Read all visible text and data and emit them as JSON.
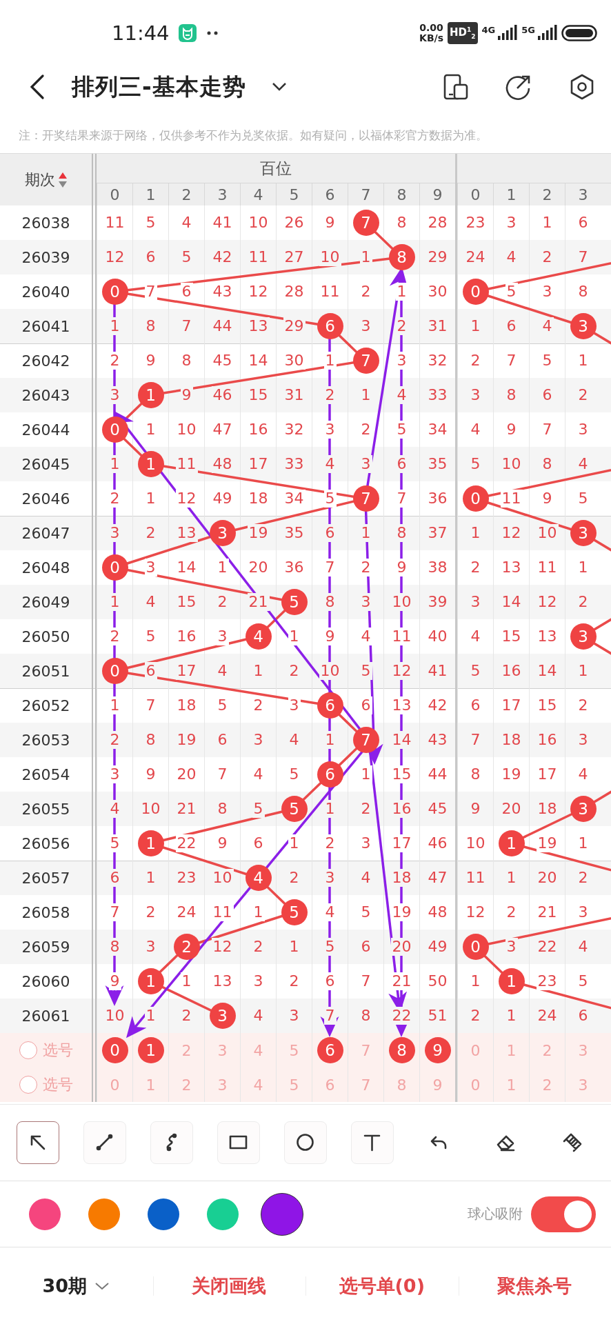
{
  "status_bar": {
    "time": "11:44",
    "net_speed": "0.00",
    "net_unit": "KB/s",
    "hd_badge": "HD$^{1}$$_{2}$",
    "sim_1": "4G",
    "sim_2": "5G"
  },
  "header": {
    "title": "排列三-基本走势"
  },
  "notice": "注：开奖结果来源于网络，仅供参考不作为兑奖依据。如有疑问，以福体彩官方数据为准。",
  "table": {
    "issue_header": "期次",
    "sort_ascending": true,
    "groups": [
      {
        "label": "百位",
        "digits": [
          "0",
          "1",
          "2",
          "3",
          "4",
          "5",
          "6",
          "7",
          "8",
          "9"
        ]
      },
      {
        "digits": [
          "0",
          "1",
          "2",
          "3"
        ]
      }
    ],
    "rows": [
      {
        "issue": "26038",
        "groups": [
          [
            {
              "text": "11",
              "hit": false
            },
            {
              "text": "5",
              "hit": false
            },
            {
              "text": "4",
              "hit": false
            },
            {
              "text": "41",
              "hit": false
            },
            {
              "text": "10",
              "hit": false
            },
            {
              "text": "26",
              "hit": false
            },
            {
              "text": "9",
              "hit": false
            },
            {
              "text": "7",
              "hit": true
            },
            {
              "text": "8",
              "hit": false
            },
            {
              "text": "28",
              "hit": false
            }
          ],
          [
            {
              "text": "23",
              "hit": false
            },
            {
              "text": "3",
              "hit": false
            },
            {
              "text": "1",
              "hit": false
            },
            {
              "text": "6",
              "hit": false
            }
          ]
        ]
      },
      {
        "issue": "26039",
        "groups": [
          [
            {
              "text": "12",
              "hit": false
            },
            {
              "text": "6",
              "hit": false
            },
            {
              "text": "5",
              "hit": false
            },
            {
              "text": "42",
              "hit": false
            },
            {
              "text": "11",
              "hit": false
            },
            {
              "text": "27",
              "hit": false
            },
            {
              "text": "10",
              "hit": false
            },
            {
              "text": "1",
              "hit": false
            },
            {
              "text": "8",
              "hit": true
            },
            {
              "text": "29",
              "hit": false
            }
          ],
          [
            {
              "text": "24",
              "hit": false
            },
            {
              "text": "4",
              "hit": false
            },
            {
              "text": "2",
              "hit": false
            },
            {
              "text": "7",
              "hit": false
            }
          ]
        ]
      },
      {
        "issue": "26040",
        "groups": [
          [
            {
              "text": "0",
              "hit": true
            },
            {
              "text": "7",
              "hit": false
            },
            {
              "text": "6",
              "hit": false
            },
            {
              "text": "43",
              "hit": false
            },
            {
              "text": "12",
              "hit": false
            },
            {
              "text": "28",
              "hit": false
            },
            {
              "text": "11",
              "hit": false
            },
            {
              "text": "2",
              "hit": false
            },
            {
              "text": "1",
              "hit": false
            },
            {
              "text": "30",
              "hit": false
            }
          ],
          [
            {
              "text": "0",
              "hit": true
            },
            {
              "text": "5",
              "hit": false
            },
            {
              "text": "3",
              "hit": false
            },
            {
              "text": "8",
              "hit": false
            }
          ]
        ]
      },
      {
        "issue": "26041",
        "groups": [
          [
            {
              "text": "1",
              "hit": false
            },
            {
              "text": "8",
              "hit": false
            },
            {
              "text": "7",
              "hit": false
            },
            {
              "text": "44",
              "hit": false
            },
            {
              "text": "13",
              "hit": false
            },
            {
              "text": "29",
              "hit": false
            },
            {
              "text": "6",
              "hit": true
            },
            {
              "text": "3",
              "hit": false
            },
            {
              "text": "2",
              "hit": false
            },
            {
              "text": "31",
              "hit": false
            }
          ],
          [
            {
              "text": "1",
              "hit": false
            },
            {
              "text": "6",
              "hit": false
            },
            {
              "text": "4",
              "hit": false
            },
            {
              "text": "3",
              "hit": true
            }
          ]
        ]
      },
      {
        "issue": "26042",
        "groups": [
          [
            {
              "text": "2",
              "hit": false
            },
            {
              "text": "9",
              "hit": false
            },
            {
              "text": "8",
              "hit": false
            },
            {
              "text": "45",
              "hit": false
            },
            {
              "text": "14",
              "hit": false
            },
            {
              "text": "30",
              "hit": false
            },
            {
              "text": "1",
              "hit": false
            },
            {
              "text": "7",
              "hit": true
            },
            {
              "text": "3",
              "hit": false
            },
            {
              "text": "32",
              "hit": false
            }
          ],
          [
            {
              "text": "2",
              "hit": false
            },
            {
              "text": "7",
              "hit": false
            },
            {
              "text": "5",
              "hit": false
            },
            {
              "text": "1",
              "hit": false
            }
          ]
        ]
      },
      {
        "issue": "26043",
        "groups": [
          [
            {
              "text": "3",
              "hit": false
            },
            {
              "text": "1",
              "hit": true
            },
            {
              "text": "9",
              "hit": false
            },
            {
              "text": "46",
              "hit": false
            },
            {
              "text": "15",
              "hit": false
            },
            {
              "text": "31",
              "hit": false
            },
            {
              "text": "2",
              "hit": false
            },
            {
              "text": "1",
              "hit": false
            },
            {
              "text": "4",
              "hit": false
            },
            {
              "text": "33",
              "hit": false
            }
          ],
          [
            {
              "text": "3",
              "hit": false
            },
            {
              "text": "8",
              "hit": false
            },
            {
              "text": "6",
              "hit": false
            },
            {
              "text": "2",
              "hit": false
            }
          ]
        ]
      },
      {
        "issue": "26044",
        "groups": [
          [
            {
              "text": "0",
              "hit": true
            },
            {
              "text": "1",
              "hit": false
            },
            {
              "text": "10",
              "hit": false
            },
            {
              "text": "47",
              "hit": false
            },
            {
              "text": "16",
              "hit": false
            },
            {
              "text": "32",
              "hit": false
            },
            {
              "text": "3",
              "hit": false
            },
            {
              "text": "2",
              "hit": false
            },
            {
              "text": "5",
              "hit": false
            },
            {
              "text": "34",
              "hit": false
            }
          ],
          [
            {
              "text": "4",
              "hit": false
            },
            {
              "text": "9",
              "hit": false
            },
            {
              "text": "7",
              "hit": false
            },
            {
              "text": "3",
              "hit": false
            }
          ]
        ]
      },
      {
        "issue": "26045",
        "groups": [
          [
            {
              "text": "1",
              "hit": false
            },
            {
              "text": "1",
              "hit": true
            },
            {
              "text": "11",
              "hit": false
            },
            {
              "text": "48",
              "hit": false
            },
            {
              "text": "17",
              "hit": false
            },
            {
              "text": "33",
              "hit": false
            },
            {
              "text": "4",
              "hit": false
            },
            {
              "text": "3",
              "hit": false
            },
            {
              "text": "6",
              "hit": false
            },
            {
              "text": "35",
              "hit": false
            }
          ],
          [
            {
              "text": "5",
              "hit": false
            },
            {
              "text": "10",
              "hit": false
            },
            {
              "text": "8",
              "hit": false
            },
            {
              "text": "4",
              "hit": false
            }
          ]
        ]
      },
      {
        "issue": "26046",
        "groups": [
          [
            {
              "text": "2",
              "hit": false
            },
            {
              "text": "1",
              "hit": false
            },
            {
              "text": "12",
              "hit": false
            },
            {
              "text": "49",
              "hit": false
            },
            {
              "text": "18",
              "hit": false
            },
            {
              "text": "34",
              "hit": false
            },
            {
              "text": "5",
              "hit": false
            },
            {
              "text": "7",
              "hit": true
            },
            {
              "text": "7",
              "hit": false
            },
            {
              "text": "36",
              "hit": false
            }
          ],
          [
            {
              "text": "0",
              "hit": true
            },
            {
              "text": "11",
              "hit": false
            },
            {
              "text": "9",
              "hit": false
            },
            {
              "text": "5",
              "hit": false
            }
          ]
        ]
      },
      {
        "issue": "26047",
        "groups": [
          [
            {
              "text": "3",
              "hit": false
            },
            {
              "text": "2",
              "hit": false
            },
            {
              "text": "13",
              "hit": false
            },
            {
              "text": "3",
              "hit": true
            },
            {
              "text": "19",
              "hit": false
            },
            {
              "text": "35",
              "hit": false
            },
            {
              "text": "6",
              "hit": false
            },
            {
              "text": "1",
              "hit": false
            },
            {
              "text": "8",
              "hit": false
            },
            {
              "text": "37",
              "hit": false
            }
          ],
          [
            {
              "text": "1",
              "hit": false
            },
            {
              "text": "12",
              "hit": false
            },
            {
              "text": "10",
              "hit": false
            },
            {
              "text": "3",
              "hit": true
            }
          ]
        ]
      },
      {
        "issue": "26048",
        "groups": [
          [
            {
              "text": "0",
              "hit": true
            },
            {
              "text": "3",
              "hit": false
            },
            {
              "text": "14",
              "hit": false
            },
            {
              "text": "1",
              "hit": false
            },
            {
              "text": "20",
              "hit": false
            },
            {
              "text": "36",
              "hit": false
            },
            {
              "text": "7",
              "hit": false
            },
            {
              "text": "2",
              "hit": false
            },
            {
              "text": "9",
              "hit": false
            },
            {
              "text": "38",
              "hit": false
            }
          ],
          [
            {
              "text": "2",
              "hit": false
            },
            {
              "text": "13",
              "hit": false
            },
            {
              "text": "11",
              "hit": false
            },
            {
              "text": "1",
              "hit": false
            }
          ]
        ]
      },
      {
        "issue": "26049",
        "groups": [
          [
            {
              "text": "1",
              "hit": false
            },
            {
              "text": "4",
              "hit": false
            },
            {
              "text": "15",
              "hit": false
            },
            {
              "text": "2",
              "hit": false
            },
            {
              "text": "21",
              "hit": false
            },
            {
              "text": "5",
              "hit": true
            },
            {
              "text": "8",
              "hit": false
            },
            {
              "text": "3",
              "hit": false
            },
            {
              "text": "10",
              "hit": false
            },
            {
              "text": "39",
              "hit": false
            }
          ],
          [
            {
              "text": "3",
              "hit": false
            },
            {
              "text": "14",
              "hit": false
            },
            {
              "text": "12",
              "hit": false
            },
            {
              "text": "2",
              "hit": false
            }
          ]
        ]
      },
      {
        "issue": "26050",
        "groups": [
          [
            {
              "text": "2",
              "hit": false
            },
            {
              "text": "5",
              "hit": false
            },
            {
              "text": "16",
              "hit": false
            },
            {
              "text": "3",
              "hit": false
            },
            {
              "text": "4",
              "hit": true
            },
            {
              "text": "1",
              "hit": false
            },
            {
              "text": "9",
              "hit": false
            },
            {
              "text": "4",
              "hit": false
            },
            {
              "text": "11",
              "hit": false
            },
            {
              "text": "40",
              "hit": false
            }
          ],
          [
            {
              "text": "4",
              "hit": false
            },
            {
              "text": "15",
              "hit": false
            },
            {
              "text": "13",
              "hit": false
            },
            {
              "text": "3",
              "hit": true
            }
          ]
        ]
      },
      {
        "issue": "26051",
        "groups": [
          [
            {
              "text": "0",
              "hit": true
            },
            {
              "text": "6",
              "hit": false
            },
            {
              "text": "17",
              "hit": false
            },
            {
              "text": "4",
              "hit": false
            },
            {
              "text": "1",
              "hit": false
            },
            {
              "text": "2",
              "hit": false
            },
            {
              "text": "10",
              "hit": false
            },
            {
              "text": "5",
              "hit": false
            },
            {
              "text": "12",
              "hit": false
            },
            {
              "text": "41",
              "hit": false
            }
          ],
          [
            {
              "text": "5",
              "hit": false
            },
            {
              "text": "16",
              "hit": false
            },
            {
              "text": "14",
              "hit": false
            },
            {
              "text": "1",
              "hit": false
            }
          ]
        ]
      },
      {
        "issue": "26052",
        "groups": [
          [
            {
              "text": "1",
              "hit": false
            },
            {
              "text": "7",
              "hit": false
            },
            {
              "text": "18",
              "hit": false
            },
            {
              "text": "5",
              "hit": false
            },
            {
              "text": "2",
              "hit": false
            },
            {
              "text": "3",
              "hit": false
            },
            {
              "text": "6",
              "hit": true
            },
            {
              "text": "6",
              "hit": false
            },
            {
              "text": "13",
              "hit": false
            },
            {
              "text": "42",
              "hit": false
            }
          ],
          [
            {
              "text": "6",
              "hit": false
            },
            {
              "text": "17",
              "hit": false
            },
            {
              "text": "15",
              "hit": false
            },
            {
              "text": "2",
              "hit": false
            }
          ]
        ]
      },
      {
        "issue": "26053",
        "groups": [
          [
            {
              "text": "2",
              "hit": false
            },
            {
              "text": "8",
              "hit": false
            },
            {
              "text": "19",
              "hit": false
            },
            {
              "text": "6",
              "hit": false
            },
            {
              "text": "3",
              "hit": false
            },
            {
              "text": "4",
              "hit": false
            },
            {
              "text": "1",
              "hit": false
            },
            {
              "text": "7",
              "hit": true
            },
            {
              "text": "14",
              "hit": false
            },
            {
              "text": "43",
              "hit": false
            }
          ],
          [
            {
              "text": "7",
              "hit": false
            },
            {
              "text": "18",
              "hit": false
            },
            {
              "text": "16",
              "hit": false
            },
            {
              "text": "3",
              "hit": false
            }
          ]
        ]
      },
      {
        "issue": "26054",
        "groups": [
          [
            {
              "text": "3",
              "hit": false
            },
            {
              "text": "9",
              "hit": false
            },
            {
              "text": "20",
              "hit": false
            },
            {
              "text": "7",
              "hit": false
            },
            {
              "text": "4",
              "hit": false
            },
            {
              "text": "5",
              "hit": false
            },
            {
              "text": "6",
              "hit": true
            },
            {
              "text": "1",
              "hit": false
            },
            {
              "text": "15",
              "hit": false
            },
            {
              "text": "44",
              "hit": false
            }
          ],
          [
            {
              "text": "8",
              "hit": false
            },
            {
              "text": "19",
              "hit": false
            },
            {
              "text": "17",
              "hit": false
            },
            {
              "text": "4",
              "hit": false
            }
          ]
        ]
      },
      {
        "issue": "26055",
        "groups": [
          [
            {
              "text": "4",
              "hit": false
            },
            {
              "text": "10",
              "hit": false
            },
            {
              "text": "21",
              "hit": false
            },
            {
              "text": "8",
              "hit": false
            },
            {
              "text": "5",
              "hit": false
            },
            {
              "text": "5",
              "hit": true
            },
            {
              "text": "1",
              "hit": false
            },
            {
              "text": "2",
              "hit": false
            },
            {
              "text": "16",
              "hit": false
            },
            {
              "text": "45",
              "hit": false
            }
          ],
          [
            {
              "text": "9",
              "hit": false
            },
            {
              "text": "20",
              "hit": false
            },
            {
              "text": "18",
              "hit": false
            },
            {
              "text": "3",
              "hit": true
            }
          ]
        ]
      },
      {
        "issue": "26056",
        "groups": [
          [
            {
              "text": "5",
              "hit": false
            },
            {
              "text": "1",
              "hit": true
            },
            {
              "text": "22",
              "hit": false
            },
            {
              "text": "9",
              "hit": false
            },
            {
              "text": "6",
              "hit": false
            },
            {
              "text": "1",
              "hit": false
            },
            {
              "text": "2",
              "hit": false
            },
            {
              "text": "3",
              "hit": false
            },
            {
              "text": "17",
              "hit": false
            },
            {
              "text": "46",
              "hit": false
            }
          ],
          [
            {
              "text": "10",
              "hit": false
            },
            {
              "text": "1",
              "hit": true
            },
            {
              "text": "19",
              "hit": false
            },
            {
              "text": "1",
              "hit": false
            }
          ]
        ]
      },
      {
        "issue": "26057",
        "groups": [
          [
            {
              "text": "6",
              "hit": false
            },
            {
              "text": "1",
              "hit": false
            },
            {
              "text": "23",
              "hit": false
            },
            {
              "text": "10",
              "hit": false
            },
            {
              "text": "4",
              "hit": true
            },
            {
              "text": "2",
              "hit": false
            },
            {
              "text": "3",
              "hit": false
            },
            {
              "text": "4",
              "hit": false
            },
            {
              "text": "18",
              "hit": false
            },
            {
              "text": "47",
              "hit": false
            }
          ],
          [
            {
              "text": "11",
              "hit": false
            },
            {
              "text": "1",
              "hit": false
            },
            {
              "text": "20",
              "hit": false
            },
            {
              "text": "2",
              "hit": false
            }
          ]
        ]
      },
      {
        "issue": "26058",
        "groups": [
          [
            {
              "text": "7",
              "hit": false
            },
            {
              "text": "2",
              "hit": false
            },
            {
              "text": "24",
              "hit": false
            },
            {
              "text": "11",
              "hit": false
            },
            {
              "text": "1",
              "hit": false
            },
            {
              "text": "5",
              "hit": true
            },
            {
              "text": "4",
              "hit": false
            },
            {
              "text": "5",
              "hit": false
            },
            {
              "text": "19",
              "hit": false
            },
            {
              "text": "48",
              "hit": false
            }
          ],
          [
            {
              "text": "12",
              "hit": false
            },
            {
              "text": "2",
              "hit": false
            },
            {
              "text": "21",
              "hit": false
            },
            {
              "text": "3",
              "hit": false
            }
          ]
        ]
      },
      {
        "issue": "26059",
        "groups": [
          [
            {
              "text": "8",
              "hit": false
            },
            {
              "text": "3",
              "hit": false
            },
            {
              "text": "2",
              "hit": true
            },
            {
              "text": "12",
              "hit": false
            },
            {
              "text": "2",
              "hit": false
            },
            {
              "text": "1",
              "hit": false
            },
            {
              "text": "5",
              "hit": false
            },
            {
              "text": "6",
              "hit": false
            },
            {
              "text": "20",
              "hit": false
            },
            {
              "text": "49",
              "hit": false
            }
          ],
          [
            {
              "text": "0",
              "hit": true
            },
            {
              "text": "3",
              "hit": false
            },
            {
              "text": "22",
              "hit": false
            },
            {
              "text": "4",
              "hit": false
            }
          ]
        ]
      },
      {
        "issue": "26060",
        "groups": [
          [
            {
              "text": "9",
              "hit": false
            },
            {
              "text": "1",
              "hit": true
            },
            {
              "text": "1",
              "hit": false
            },
            {
              "text": "13",
              "hit": false
            },
            {
              "text": "3",
              "hit": false
            },
            {
              "text": "2",
              "hit": false
            },
            {
              "text": "6",
              "hit": false
            },
            {
              "text": "7",
              "hit": false
            },
            {
              "text": "21",
              "hit": false
            },
            {
              "text": "50",
              "hit": false
            }
          ],
          [
            {
              "text": "1",
              "hit": false
            },
            {
              "text": "1",
              "hit": true
            },
            {
              "text": "23",
              "hit": false
            },
            {
              "text": "5",
              "hit": false
            }
          ]
        ]
      },
      {
        "issue": "26061",
        "groups": [
          [
            {
              "text": "10",
              "hit": false
            },
            {
              "text": "1",
              "hit": false
            },
            {
              "text": "2",
              "hit": false
            },
            {
              "text": "3",
              "hit": true
            },
            {
              "text": "4",
              "hit": false
            },
            {
              "text": "3",
              "hit": false
            },
            {
              "text": "7",
              "hit": false
            },
            {
              "text": "8",
              "hit": false
            },
            {
              "text": "22",
              "hit": false
            },
            {
              "text": "51",
              "hit": false
            }
          ],
          [
            {
              "text": "2",
              "hit": false
            },
            {
              "text": "1",
              "hit": false
            },
            {
              "text": "24",
              "hit": false
            },
            {
              "text": "6",
              "hit": false
            }
          ]
        ]
      }
    ],
    "pick_rows": [
      {
        "label": "选号",
        "selected": false,
        "groups": [
          [
            {
              "text": "0",
              "selected": true
            },
            {
              "text": "1",
              "selected": true
            },
            {
              "text": "2",
              "selected": false
            },
            {
              "text": "3",
              "selected": false
            },
            {
              "text": "4",
              "selected": false
            },
            {
              "text": "5",
              "selected": false
            },
            {
              "text": "6",
              "selected": true
            },
            {
              "text": "7",
              "selected": false
            },
            {
              "text": "8",
              "selected": true
            },
            {
              "text": "9",
              "selected": true
            }
          ],
          [
            {
              "text": "0",
              "selected": false
            },
            {
              "text": "1",
              "selected": false
            },
            {
              "text": "2",
              "selected": false
            },
            {
              "text": "3",
              "selected": false
            }
          ]
        ]
      },
      {
        "label": "选号",
        "selected": false,
        "groups": [
          [
            {
              "text": "0",
              "selected": false
            },
            {
              "text": "1",
              "selected": false
            },
            {
              "text": "2",
              "selected": false
            },
            {
              "text": "3",
              "selected": false
            },
            {
              "text": "4",
              "selected": false
            },
            {
              "text": "5",
              "selected": false
            },
            {
              "text": "6",
              "selected": false
            },
            {
              "text": "7",
              "selected": false
            },
            {
              "text": "8",
              "selected": false
            },
            {
              "text": "9",
              "selected": false
            }
          ],
          [
            {
              "text": "0",
              "selected": false
            },
            {
              "text": "1",
              "selected": false
            },
            {
              "text": "2",
              "selected": false
            },
            {
              "text": "3",
              "selected": false
            }
          ]
        ]
      }
    ]
  },
  "tools": [
    {
      "kind": "arrow",
      "selected": true
    },
    {
      "kind": "line",
      "selected": false
    },
    {
      "kind": "curve",
      "selected": false
    },
    {
      "kind": "rectangle",
      "selected": false
    },
    {
      "kind": "circle",
      "selected": false
    },
    {
      "kind": "text",
      "selected": false
    },
    {
      "kind": "undo",
      "selected": false
    },
    {
      "kind": "eraser",
      "selected": false
    },
    {
      "kind": "clear",
      "selected": false
    }
  ],
  "colors": [
    {
      "color": "#f5457e",
      "selected": false
    },
    {
      "color": "#f77a00",
      "selected": false
    },
    {
      "color": "#0a60c8",
      "selected": false
    },
    {
      "color": "#18cf93",
      "selected": false
    },
    {
      "color": "#8f15e6",
      "selected": true
    }
  ],
  "snap": {
    "label": "球心吸附",
    "on": true
  },
  "bottom_bar": {
    "period": "30期",
    "actions": [
      "关闭画线",
      "选号单(0)",
      "聚焦杀号"
    ]
  }
}
